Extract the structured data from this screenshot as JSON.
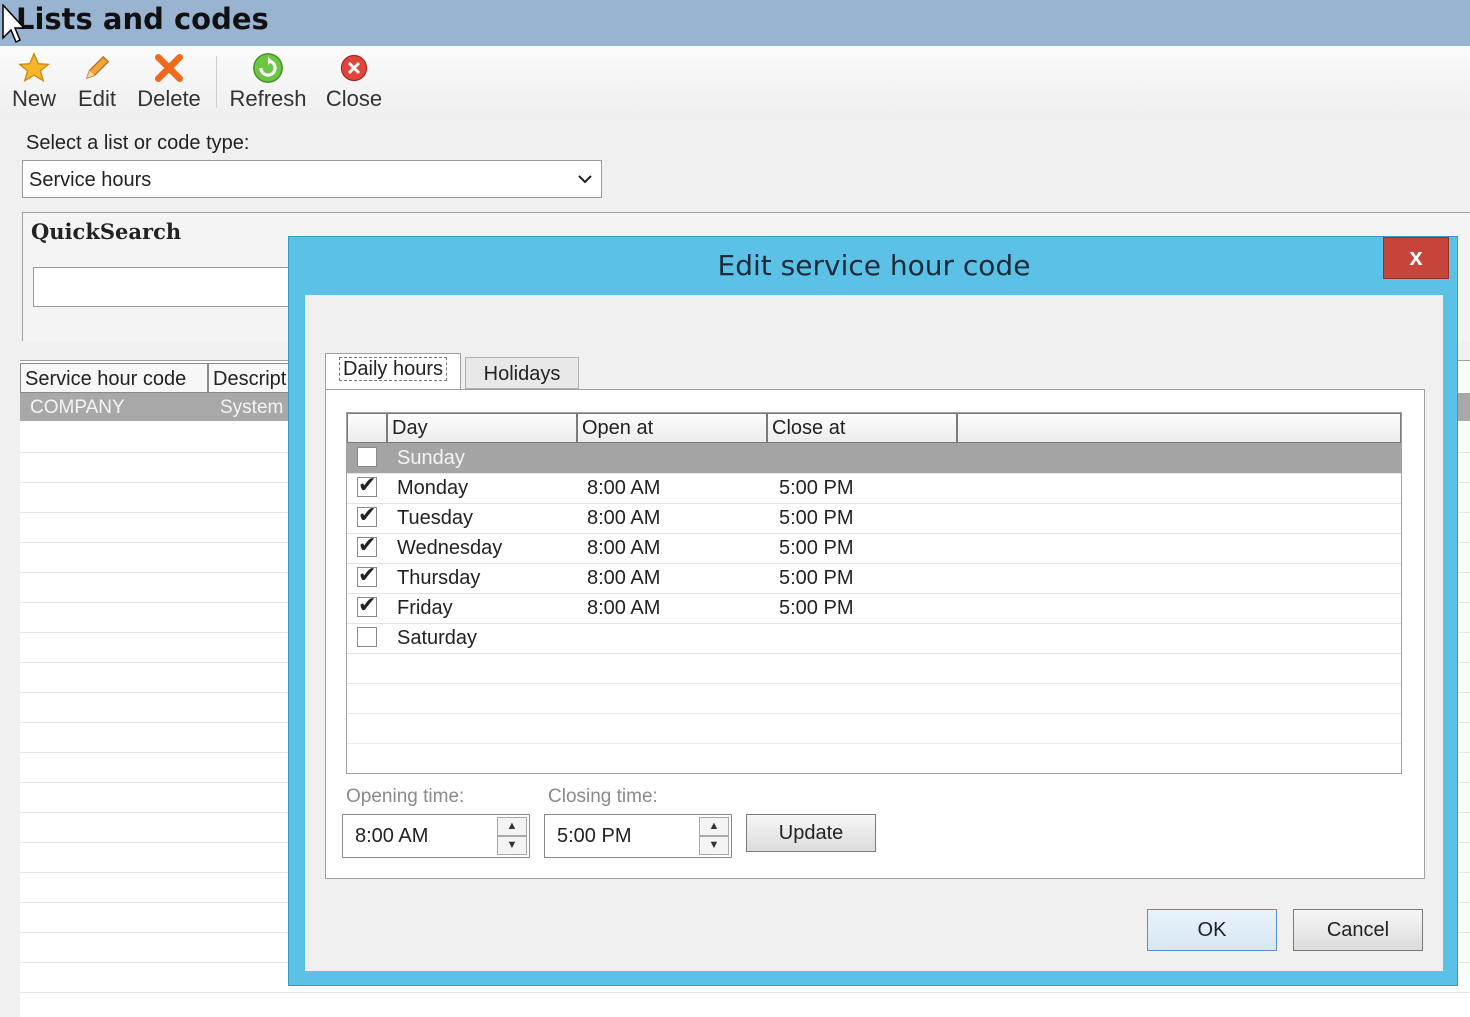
{
  "window": {
    "title": "Lists and codes"
  },
  "toolbar": {
    "new_label": "New",
    "edit_label": "Edit",
    "delete_label": "Delete",
    "refresh_label": "Refresh",
    "close_label": "Close"
  },
  "selector": {
    "label": "Select a list or code type:",
    "value": "Service hours"
  },
  "quicksearch": {
    "title": "QuickSearch",
    "value": ""
  },
  "main_grid": {
    "columns": [
      "Service hour code",
      "Descript"
    ],
    "rows": [
      {
        "code": "COMPANY",
        "description": "System"
      }
    ]
  },
  "dialog": {
    "title": "Edit service hour code",
    "close_glyph": "x",
    "tabs": [
      "Daily hours",
      "Holidays"
    ],
    "grid": {
      "columns": [
        "Day",
        "Open at",
        "Close at"
      ],
      "rows": [
        {
          "checked": false,
          "day": "Sunday",
          "open": "",
          "close": "",
          "selected": true
        },
        {
          "checked": true,
          "day": "Monday",
          "open": "8:00 AM",
          "close": "5:00 PM"
        },
        {
          "checked": true,
          "day": "Tuesday",
          "open": "8:00 AM",
          "close": "5:00 PM"
        },
        {
          "checked": true,
          "day": "Wednesday",
          "open": "8:00 AM",
          "close": "5:00 PM"
        },
        {
          "checked": true,
          "day": "Thursday",
          "open": "8:00 AM",
          "close": "5:00 PM"
        },
        {
          "checked": true,
          "day": "Friday",
          "open": "8:00 AM",
          "close": "5:00 PM"
        },
        {
          "checked": false,
          "day": "Saturday",
          "open": "",
          "close": ""
        }
      ]
    },
    "opening_label": "Opening time:",
    "opening_value": "8:00 AM",
    "closing_label": "Closing time:",
    "closing_value": "5:00 PM",
    "update_label": "Update",
    "ok_label": "OK",
    "cancel_label": "Cancel"
  }
}
